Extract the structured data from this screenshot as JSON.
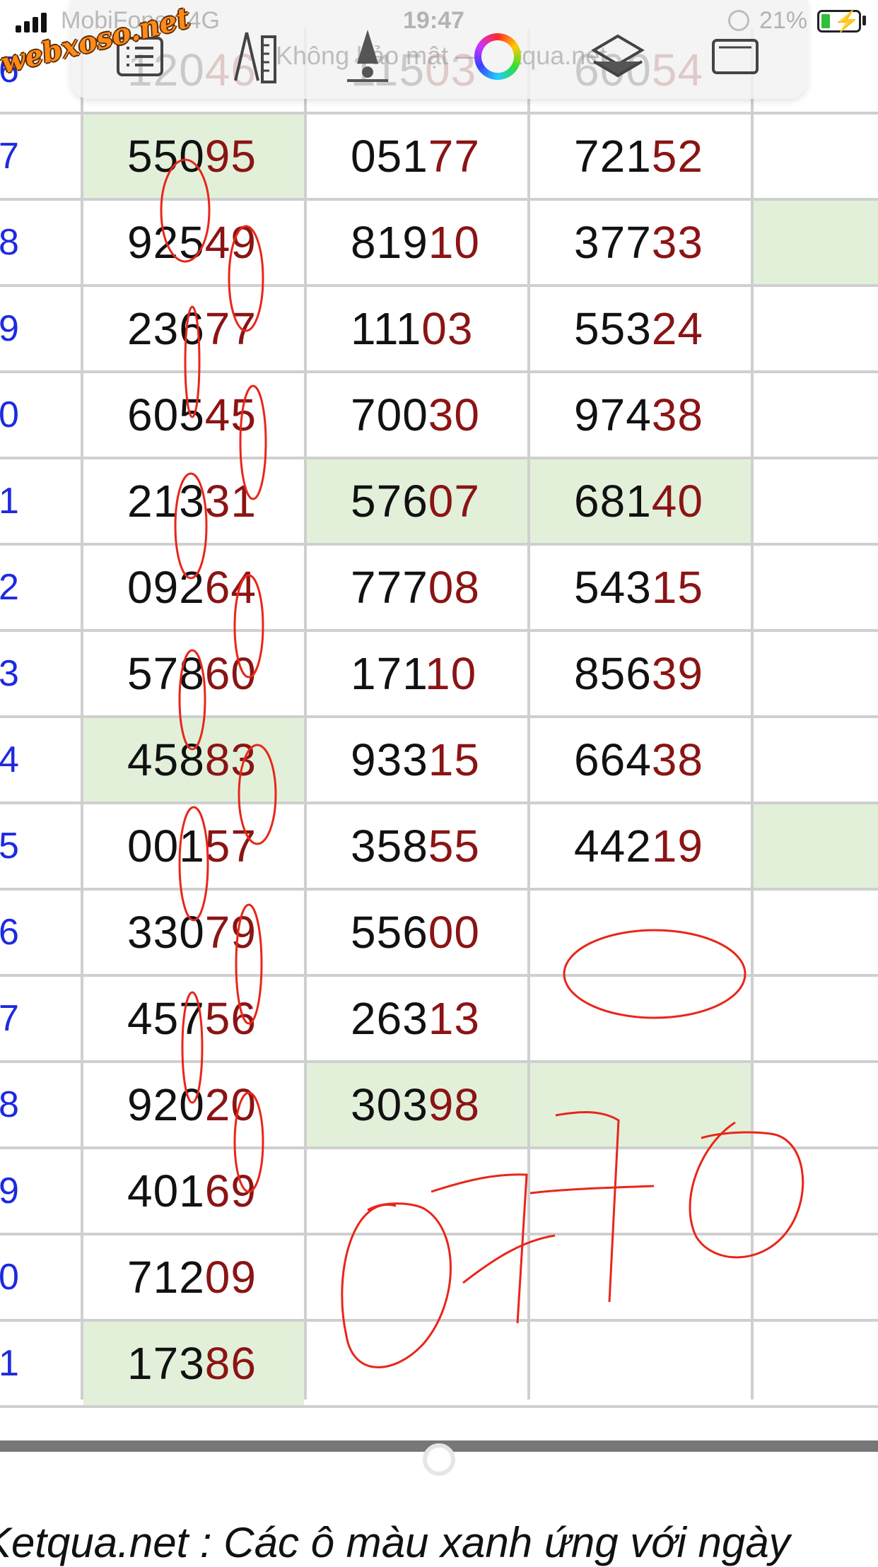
{
  "status_bar": {
    "carrier": "MobiFone",
    "network": "4G",
    "time": "19:47",
    "battery_percent": "21%"
  },
  "browser": {
    "url_text": "Không bảo mật — ketqua.net",
    "tools": [
      "list-icon",
      "ruler-pencil-icon",
      "pen-icon",
      "color-wheel-icon",
      "layers-icon",
      "frame-icon"
    ]
  },
  "watermark": "webxoso.net",
  "table": {
    "highlight_color": "#e2f0da",
    "tail_color": "#8b1414",
    "day_color": "#1d2ae0",
    "rows": [
      {
        "day": "6",
        "c1": {
          "head": "120",
          "tail": "46"
        },
        "c2": {
          "head": "115",
          "tail": "03"
        },
        "c3": {
          "head": "600",
          "tail": "54"
        }
      },
      {
        "day": "7",
        "c1": {
          "head": "550",
          "tail": "95"
        },
        "c2": {
          "head": "051",
          "tail": "77"
        },
        "c3": {
          "head": "721",
          "tail": "52"
        }
      },
      {
        "day": "8",
        "c1": {
          "head": "925",
          "tail": "49"
        },
        "c2": {
          "head": "819",
          "tail": "10"
        },
        "c3": {
          "head": "377",
          "tail": "33"
        }
      },
      {
        "day": "9",
        "c1": {
          "head": "236",
          "tail": "77"
        },
        "c2": {
          "head": "111",
          "tail": "03"
        },
        "c3": {
          "head": "553",
          "tail": "24"
        }
      },
      {
        "day": "0",
        "c1": {
          "head": "605",
          "tail": "45"
        },
        "c2": {
          "head": "700",
          "tail": "30"
        },
        "c3": {
          "head": "974",
          "tail": "38"
        }
      },
      {
        "day": "1",
        "c1": {
          "head": "213",
          "tail": "31"
        },
        "c2": {
          "head": "576",
          "tail": "07"
        },
        "c3": {
          "head": "681",
          "tail": "40"
        }
      },
      {
        "day": "2",
        "c1": {
          "head": "092",
          "tail": "64"
        },
        "c2": {
          "head": "777",
          "tail": "08"
        },
        "c3": {
          "head": "543",
          "tail": "15"
        }
      },
      {
        "day": "3",
        "c1": {
          "head": "578",
          "tail": "60"
        },
        "c2": {
          "head": "171",
          "tail": "10"
        },
        "c3": {
          "head": "856",
          "tail": "39"
        }
      },
      {
        "day": "4",
        "c1": {
          "head": "458",
          "tail": "83"
        },
        "c2": {
          "head": "933",
          "tail": "15"
        },
        "c3": {
          "head": "664",
          "tail": "38"
        }
      },
      {
        "day": "5",
        "c1": {
          "head": "001",
          "tail": "57"
        },
        "c2": {
          "head": "358",
          "tail": "55"
        },
        "c3": {
          "head": "442",
          "tail": "19"
        }
      },
      {
        "day": "6",
        "c1": {
          "head": "330",
          "tail": "79"
        },
        "c2": {
          "head": "556",
          "tail": "00"
        },
        "c3": {
          "head": "",
          "tail": ""
        }
      },
      {
        "day": "7",
        "c1": {
          "head": "457",
          "tail": "56"
        },
        "c2": {
          "head": "263",
          "tail": "13"
        },
        "c3": {
          "head": "",
          "tail": ""
        }
      },
      {
        "day": "8",
        "c1": {
          "head": "920",
          "tail": "20"
        },
        "c2": {
          "head": "303",
          "tail": "98"
        },
        "c3": {
          "head": "",
          "tail": ""
        }
      },
      {
        "day": "9",
        "c1": {
          "head": "401",
          "tail": "69"
        },
        "c2": {
          "head": "",
          "tail": ""
        },
        "c3": {
          "head": "",
          "tail": ""
        }
      },
      {
        "day": "0",
        "c1": {
          "head": "712",
          "tail": "09"
        },
        "c2": {
          "head": "",
          "tail": ""
        },
        "c3": {
          "head": "",
          "tail": ""
        }
      },
      {
        "day": "1",
        "c1": {
          "head": "173",
          "tail": "86"
        },
        "c2": {
          "head": "",
          "tail": ""
        },
        "c3": {
          "head": "",
          "tail": ""
        }
      }
    ],
    "highlighted": [
      {
        "row": 1,
        "col": 1
      },
      {
        "row": 5,
        "col": 2
      },
      {
        "row": 5,
        "col": 3
      },
      {
        "row": 8,
        "col": 1
      },
      {
        "row": 12,
        "col": 2
      },
      {
        "row": 12,
        "col": 3
      },
      {
        "row": 15,
        "col": 1
      },
      {
        "row": 2,
        "col": 4
      },
      {
        "row": 9,
        "col": 4
      }
    ]
  },
  "handwriting": "0170",
  "footer": "Ketqua.net : Các ô màu xanh ứng với ngày"
}
